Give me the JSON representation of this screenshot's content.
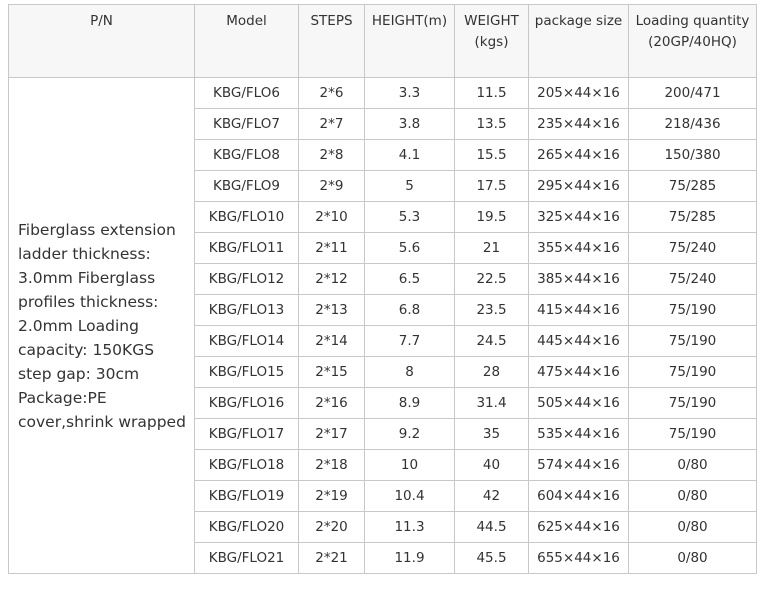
{
  "headers": {
    "pn": "P/N",
    "model": "Model",
    "steps": "STEPS",
    "height": "HEIGHT(m)",
    "weight": "WEIGHT (kgs)",
    "package": "package size",
    "loading": "Loading quantity (20GP/40HQ)"
  },
  "description": "Fiberglass extension\nladder thickness:\n3.0mm Fiberglass\nprofiles thickness:\n2.0mm   Loading\ncapacity: 150KGS\nstep gap: 30cm\nPackage:PE\ncover,shrink wrapped",
  "rows": [
    {
      "model": "KBG/FLO6",
      "steps": "2*6",
      "height": "3.3",
      "weight": "11.5",
      "package": "205×44×16",
      "loading": "200/471"
    },
    {
      "model": "KBG/FLO7",
      "steps": "2*7",
      "height": "3.8",
      "weight": "13.5",
      "package": "235×44×16",
      "loading": "218/436"
    },
    {
      "model": "KBG/FLO8",
      "steps": "2*8",
      "height": "4.1",
      "weight": "15.5",
      "package": "265×44×16",
      "loading": "150/380"
    },
    {
      "model": "KBG/FLO9",
      "steps": "2*9",
      "height": "5",
      "weight": "17.5",
      "package": "295×44×16",
      "loading": "75/285"
    },
    {
      "model": "KBG/FLO10",
      "steps": "2*10",
      "height": "5.3",
      "weight": "19.5",
      "package": "325×44×16",
      "loading": "75/285"
    },
    {
      "model": "KBG/FLO11",
      "steps": "2*11",
      "height": "5.6",
      "weight": "21",
      "package": "355×44×16",
      "loading": "75/240"
    },
    {
      "model": "KBG/FLO12",
      "steps": "2*12",
      "height": "6.5",
      "weight": "22.5",
      "package": "385×44×16",
      "loading": "75/240"
    },
    {
      "model": "KBG/FLO13",
      "steps": "2*13",
      "height": "6.8",
      "weight": "23.5",
      "package": "415×44×16",
      "loading": "75/190"
    },
    {
      "model": "KBG/FLO14",
      "steps": "2*14",
      "height": "7.7",
      "weight": "24.5",
      "package": "445×44×16",
      "loading": "75/190"
    },
    {
      "model": "KBG/FLO15",
      "steps": "2*15",
      "height": "8",
      "weight": "28",
      "package": "475×44×16",
      "loading": "75/190"
    },
    {
      "model": "KBG/FLO16",
      "steps": "2*16",
      "height": "8.9",
      "weight": "31.4",
      "package": "505×44×16",
      "loading": "75/190"
    },
    {
      "model": "KBG/FLO17",
      "steps": "2*17",
      "height": "9.2",
      "weight": "35",
      "package": "535×44×16",
      "loading": "75/190"
    },
    {
      "model": "KBG/FLO18",
      "steps": "2*18",
      "height": "10",
      "weight": "40",
      "package": "574×44×16",
      "loading": "0/80"
    },
    {
      "model": "KBG/FLO19",
      "steps": "2*19",
      "height": "10.4",
      "weight": "42",
      "package": "604×44×16",
      "loading": "0/80"
    },
    {
      "model": "KBG/FLO20",
      "steps": "2*20",
      "height": "11.3",
      "weight": "44.5",
      "package": "625×44×16",
      "loading": "0/80"
    },
    {
      "model": "KBG/FLO21",
      "steps": "2*21",
      "height": "11.9",
      "weight": "45.5",
      "package": "655×44×16",
      "loading": "0/80"
    }
  ]
}
